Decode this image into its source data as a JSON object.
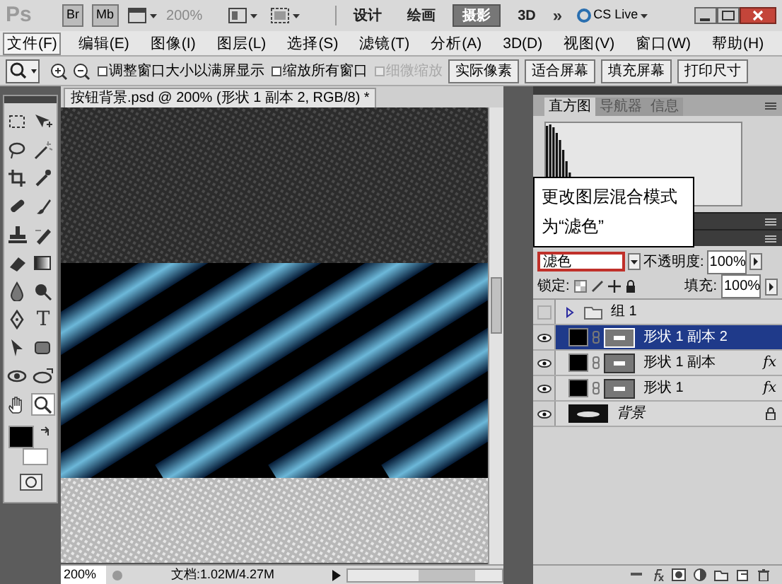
{
  "app": {
    "logo": "Ps",
    "bridge": "Br",
    "mini_bridge": "Mb",
    "zoom": "200%",
    "workspaces": [
      {
        "label": "设计",
        "selected": false
      },
      {
        "label": "绘画",
        "selected": false
      },
      {
        "label": "摄影",
        "selected": true
      },
      {
        "label": "3D",
        "selected": false
      }
    ],
    "overflow": "»",
    "cs_live": "CS Live"
  },
  "menu": [
    {
      "label": "文件(F)",
      "selected": true
    },
    {
      "label": "编辑(E)",
      "selected": false
    },
    {
      "label": "图像(I)",
      "selected": false
    },
    {
      "label": "图层(L)",
      "selected": false
    },
    {
      "label": "选择(S)",
      "selected": false
    },
    {
      "label": "滤镜(T)",
      "selected": false
    },
    {
      "label": "分析(A)",
      "selected": false
    },
    {
      "label": "3D(D)",
      "selected": false
    },
    {
      "label": "视图(V)",
      "selected": false
    },
    {
      "label": "窗口(W)",
      "selected": false
    },
    {
      "label": "帮助(H)",
      "selected": false
    }
  ],
  "options": {
    "checkboxes": [
      {
        "label": "调整窗口大小以满屏显示",
        "checked": false,
        "disabled": false
      },
      {
        "label": "缩放所有窗口",
        "checked": false,
        "disabled": false
      },
      {
        "label": "细微缩放",
        "checked": false,
        "disabled": true
      }
    ],
    "buttons": [
      "实际像素",
      "适合屏幕",
      "填充屏幕",
      "打印尺寸"
    ]
  },
  "tools": {
    "type_glyph": "T"
  },
  "document": {
    "tab": "按钮背景.psd @ 200% (形状 1 副本 2, RGB/8) *",
    "zoom": "200%",
    "info": "文档:1.02M/4.27M"
  },
  "panels": {
    "tabs": [
      {
        "label": "直方图",
        "selected": true
      },
      {
        "label": "导航器",
        "selected": false
      },
      {
        "label": "信息",
        "selected": false
      }
    ],
    "callout": [
      "更改图层混合模式",
      "为“滤色”"
    ],
    "blend_mode": "滤色",
    "opacity_label": "不透明度:",
    "opacity": "100%",
    "lock_label": "锁定:",
    "fill_label": "填充:",
    "fill": "100%",
    "layers": [
      {
        "kind": "group",
        "name": "组 1",
        "visible": false,
        "selected": false
      },
      {
        "kind": "shape",
        "name": "形状 1 副本 2",
        "visible": true,
        "selected": true
      },
      {
        "kind": "shape",
        "name": "形状 1 副本",
        "visible": true,
        "selected": false,
        "effects": "fx"
      },
      {
        "kind": "shape",
        "name": "形状 1",
        "visible": true,
        "selected": false,
        "effects": "fx"
      },
      {
        "kind": "background",
        "name": "背景",
        "visible": true,
        "selected": false
      }
    ]
  }
}
